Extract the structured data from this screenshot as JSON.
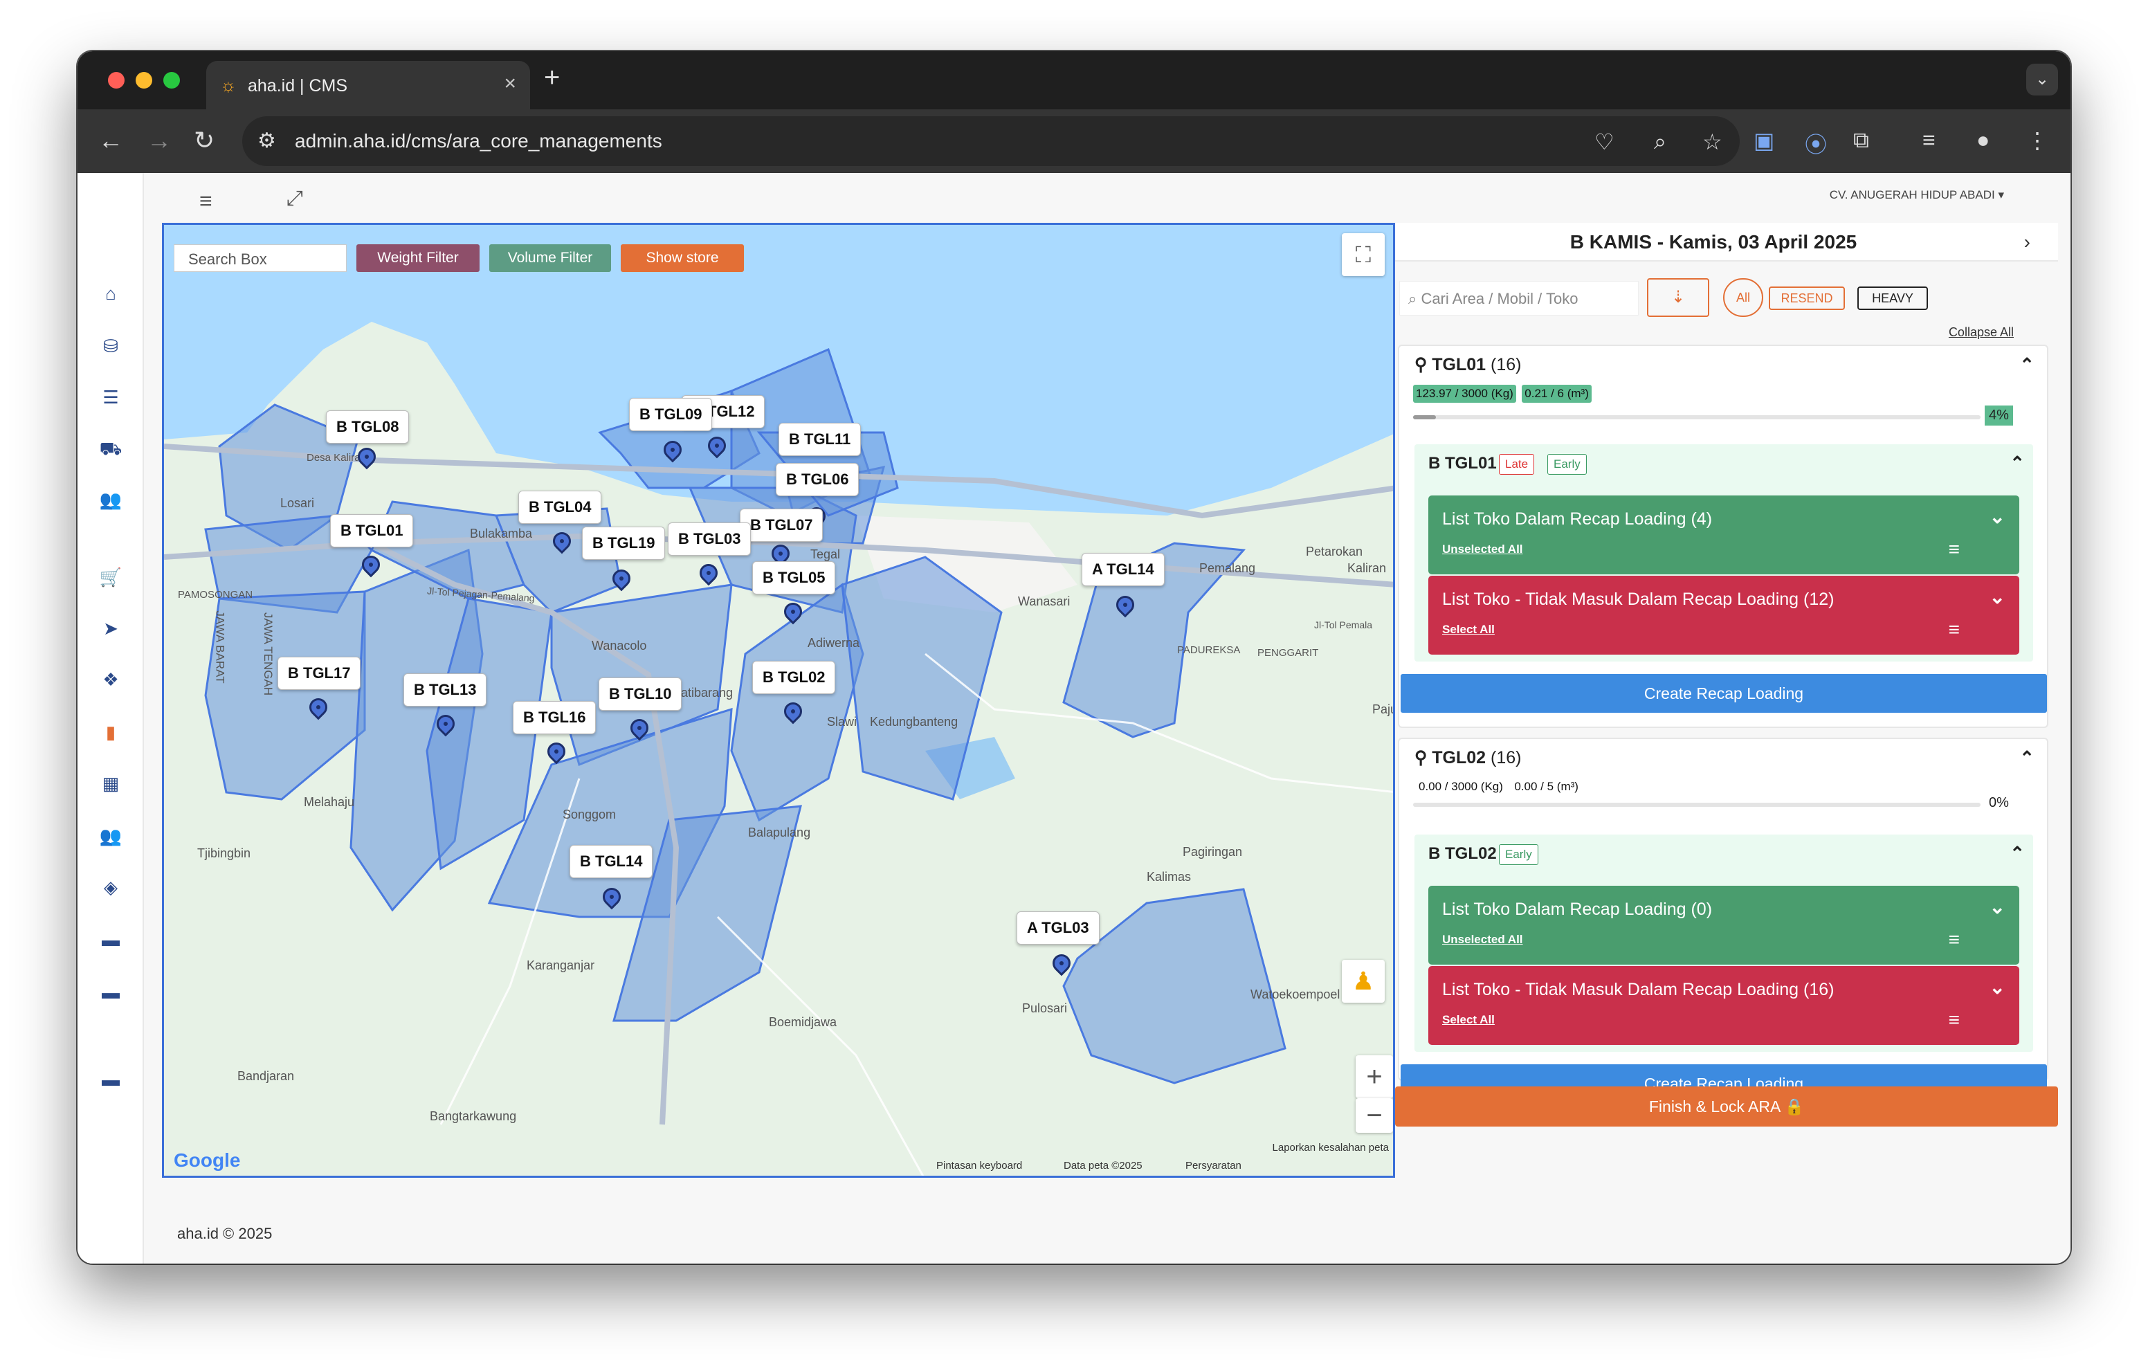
{
  "browser": {
    "tab_title": "aha.id | CMS",
    "url": "admin.aha.id/cms/ara_core_managements"
  },
  "topbar": {
    "company": "CV. ANUGERAH HIDUP ABADI ▾"
  },
  "map": {
    "search_placeholder": "Search Box",
    "filters": {
      "weight": "Weight Filter",
      "volume": "Volume Filter",
      "show_store": "Show store"
    },
    "markers": [
      {
        "label": "B TGL08"
      },
      {
        "label": "B TGL09"
      },
      {
        "label": "B TGL12"
      },
      {
        "label": "B TGL11"
      },
      {
        "label": "B TGL06"
      },
      {
        "label": "B TGL04"
      },
      {
        "label": "B TGL07"
      },
      {
        "label": "B TGL01"
      },
      {
        "label": "B TGL19"
      },
      {
        "label": "B TGL03"
      },
      {
        "label": "B TGL05"
      },
      {
        "label": "A TGL14"
      },
      {
        "label": "B TGL17"
      },
      {
        "label": "B TGL13"
      },
      {
        "label": "B TGL10"
      },
      {
        "label": "B TGL02"
      },
      {
        "label": "B TGL16"
      },
      {
        "label": "B TGL14"
      },
      {
        "label": "A TGL03"
      }
    ],
    "places": [
      "Desa Kaliraiyu",
      "Losari",
      "Bulakamba",
      "Jatibarang",
      "Wanacolo",
      "Slawi",
      "Kedungbanteng",
      "Wanasari",
      "Pemalang",
      "Petarokan",
      "Kaliran",
      "PAMOSONGAN",
      "JAWA BARAT",
      "JAWA TENGAH",
      "Melahaju",
      "Tjibingbin",
      "Songgom",
      "Balapulang",
      "Pagiringan",
      "Kalimas",
      "Karanganjar",
      "Boemidjawa",
      "Pulosari",
      "Watoekoempoel",
      "Bandjaran",
      "Bangtarkawung",
      "Adiwerna",
      "Tegal",
      "PADUREKSA",
      "PENGGARIT",
      "Pajur",
      "Jl-Tol Pejagan-Pemalang",
      "Jl-Tol Pemala"
    ],
    "attribution": {
      "keyboard": "Pintasan keyboard",
      "data": "Data peta ©2025",
      "terms": "Persyaratan",
      "report": "Laporkan kesalahan peta"
    },
    "google": "Google"
  },
  "footer": "aha.id © 2025",
  "panel": {
    "title": "B KAMIS - Kamis, 03 April 2025",
    "search_placeholder": "Cari Area / Mobil / Toko",
    "filters": {
      "all": "All",
      "resend": "RESEND",
      "heavy": "HEAVY"
    },
    "collapse_all": "Collapse All",
    "groups": [
      {
        "name": "TGL01",
        "count": "(16)",
        "weight": "123.97 / 3000 (Kg)",
        "volume": "0.21 / 6 (m³)",
        "percent": "4%",
        "progress": 0.04,
        "sub": {
          "name": "B TGL01",
          "badges": [
            "Late",
            "Early"
          ],
          "in_list": {
            "title": "List Toko Dalam Recap Loading (4)",
            "action": "Unselected All"
          },
          "out_list": {
            "title": "List Toko - Tidak Masuk Dalam Recap Loading (12)",
            "action": "Select All"
          }
        },
        "create_label": "Create Recap Loading"
      },
      {
        "name": "TGL02",
        "count": "(16)",
        "weight": "0.00 / 3000 (Kg)",
        "volume": "0.00 / 5 (m³)",
        "percent": "0%",
        "progress": 0.0,
        "sub": {
          "name": "B TGL02",
          "badges": [
            "Early"
          ],
          "in_list": {
            "title": "List Toko Dalam Recap Loading (0)",
            "action": "Unselected All"
          },
          "out_list": {
            "title": "List Toko - Tidak Masuk Dalam Recap Loading (16)",
            "action": "Select All"
          }
        },
        "create_label": "Create Recap Loading"
      }
    ],
    "finish_label": "Finish & Lock ARA 🔒"
  },
  "colors": {
    "accent_blue": "#3d8be0",
    "green": "#4a9d6e",
    "red": "#c9304b",
    "orange": "#e36f36",
    "weight_filter": "#8e4f6a",
    "volume_filter": "#5d9c84"
  }
}
